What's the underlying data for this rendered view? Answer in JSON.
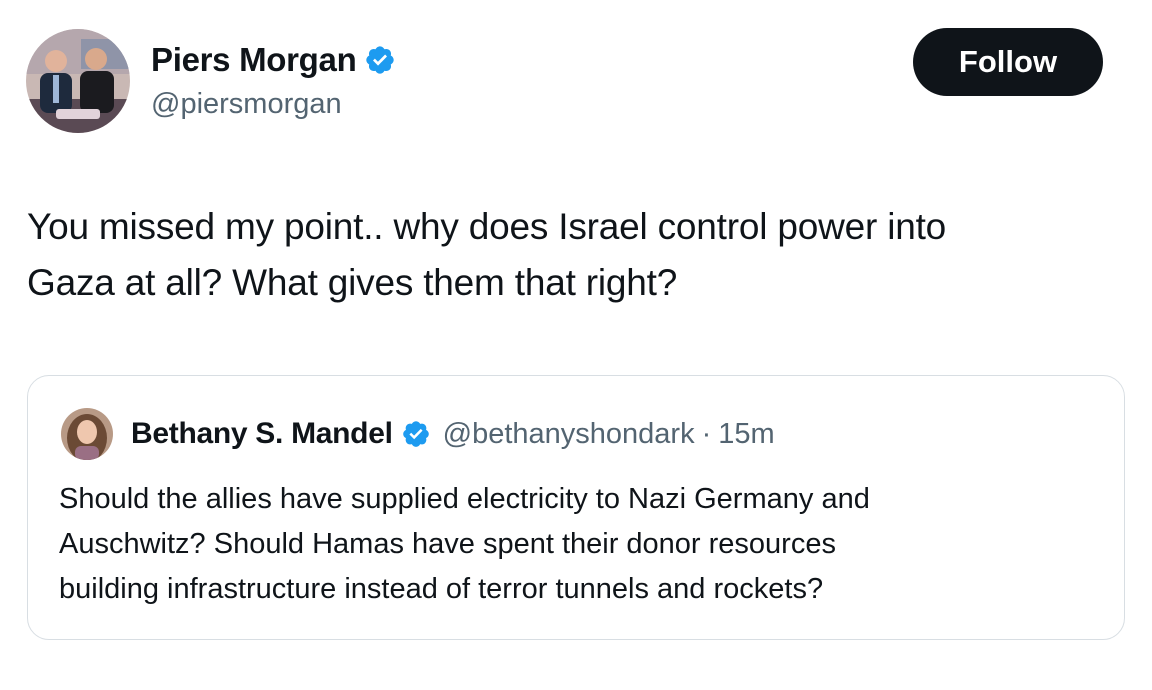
{
  "tweet": {
    "author": {
      "name": "Piers Morgan",
      "handle": "@piersmorgan",
      "verified": true
    },
    "follow_label": "Follow",
    "text": "You missed my point.. why does Israel control power into\nGaza at all? What gives them that right?"
  },
  "quoted_tweet": {
    "author": {
      "name": "Bethany S. Mandel",
      "handle": "@bethanyshondark",
      "verified": true
    },
    "separator": "·",
    "time": "15m",
    "text": "Should the allies have supplied electricity to Nazi Germany and\nAuschwitz? Should Hamas have spent their donor resources\nbuilding infrastructure instead of terror tunnels and rockets?"
  },
  "colors": {
    "verified_badge": "#1d9bf0",
    "follow_button_bg": "#0f1419",
    "secondary_text": "#536471",
    "card_border": "#d8dee3"
  },
  "icons": {
    "verified": "verified-badge-icon"
  }
}
